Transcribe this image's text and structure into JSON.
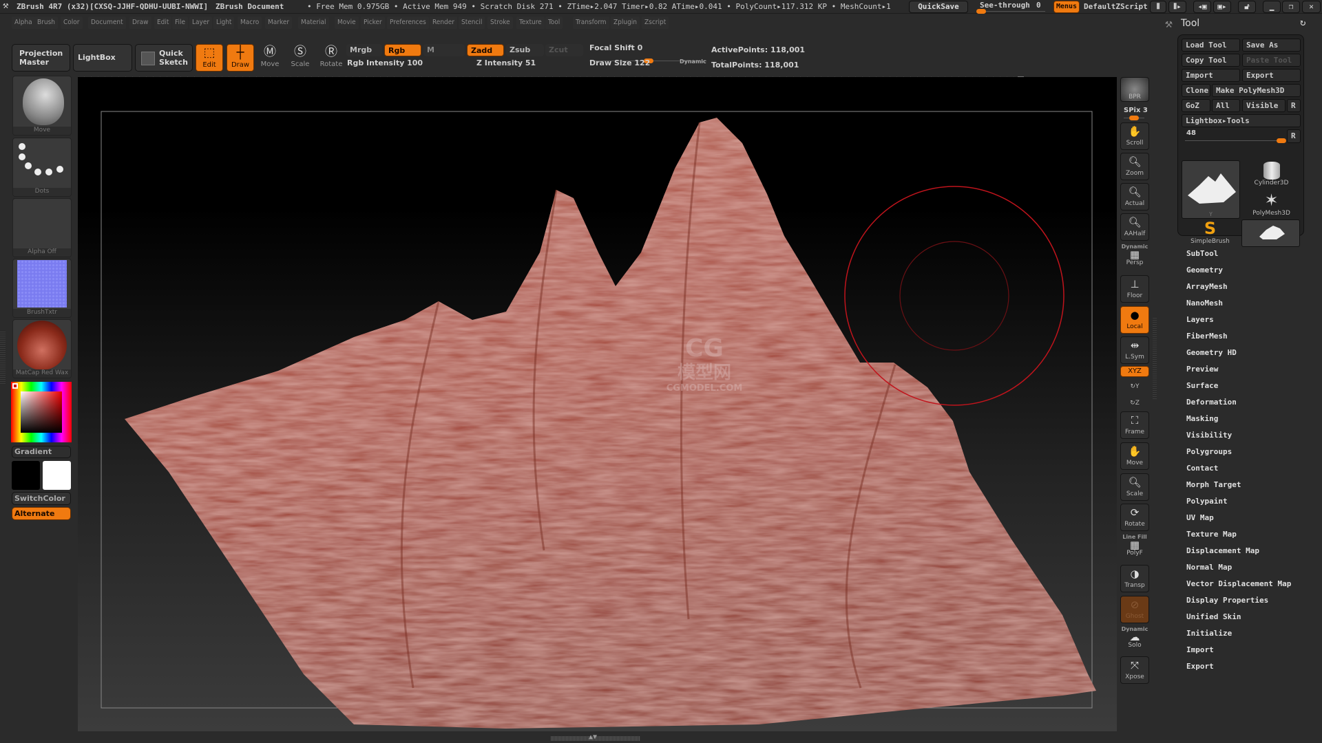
{
  "titlebar": {
    "app": "ZBrush 4R7 (x32)[CXSQ-JJHF-QDHU-UUBI-NWWI]",
    "document": "ZBrush Document",
    "stats": "• Free Mem 0.975GB • Active Mem 949 • Scratch Disk 271 • ZTime▸2.047 Timer▸0.82 ATime▸0.041 • PolyCount▸117.312 KP • MeshCount▸1",
    "quicksave": "QuickSave",
    "see_through_label": "See-through",
    "see_through_value": "0",
    "see_through_level": 0,
    "menus": "Menus",
    "script": "DefaultZScript"
  },
  "menubar": [
    "Alpha",
    "Brush",
    "Color",
    "Document",
    "Draw",
    "Edit",
    "File",
    "Layer",
    "Light",
    "Macro",
    "Marker",
    "Material",
    "Movie",
    "Picker",
    "Preferences",
    "Render",
    "Stencil",
    "Stroke",
    "Texture",
    "Tool",
    "Transform",
    "Zplugin",
    "Zscript"
  ],
  "toolbar": {
    "projection_master": [
      "Projection",
      "Master"
    ],
    "lightbox": "LightBox",
    "quick_sketch": [
      "Quick",
      "Sketch"
    ],
    "edit": "Edit",
    "draw": "Draw",
    "move": "Move",
    "scale": "Scale",
    "rotate": "Rotate",
    "mrgb": "Mrgb",
    "rgb": "Rgb",
    "m": "M",
    "zadd": "Zadd",
    "zsub": "Zsub",
    "zcut": "Zcut",
    "rgb_intensity": "Rgb Intensity 100",
    "rgb_intensity_value": 100,
    "z_intensity": "Z Intensity 51",
    "z_intensity_value": 51,
    "focal_shift": "Focal Shift 0",
    "focal_shift_value": 0,
    "draw_size": "Draw Size 122",
    "draw_size_value": 122,
    "dynamic": "Dynamic",
    "active_points": "ActivePoints: 118,001",
    "total_points": "TotalPoints: 118,001"
  },
  "leftpanel": {
    "brush": "Move",
    "stroke": "Dots",
    "alpha": "Alpha Off",
    "texture": "BrushTxtr",
    "material": "MatCap Red Wax",
    "gradient": "Gradient",
    "switch_color": "SwitchColor",
    "alternate": "Alternate",
    "main_color": "#000000",
    "secondary_color": "#ffffff"
  },
  "shelf": {
    "bpr": "BPR",
    "spix": "SPix 3",
    "scroll": "Scroll",
    "zoom": "Zoom",
    "actual": "Actual",
    "aahalf": "AAHalf",
    "dynamic": "Dynamic",
    "persp": "Persp",
    "floor": "Floor",
    "local": "Local",
    "lsym": "L.Sym",
    "xyz": "XYZ",
    "y": "Y",
    "z": "Z",
    "frame": "Frame",
    "move": "Move",
    "scale": "Scale",
    "rotate": "Rotate",
    "line_fill": "Line Fill",
    "polyf": "PolyF",
    "transp": "Transp",
    "ghost": "Ghost",
    "dynamic2": "Dynamic",
    "solo": "Solo",
    "xpose": "Xpose"
  },
  "toolpanel": {
    "title": "Tool",
    "load_tool": "Load Tool",
    "save_as": "Save As",
    "copy_tool": "Copy Tool",
    "paste_tool": "Paste Tool",
    "import": "Import",
    "export": "Export",
    "clone": "Clone",
    "make_polymesh": "Make PolyMesh3D",
    "goz": "GoZ",
    "all": "All",
    "visible": "Visible",
    "r": "R",
    "lightbox_tools": "Lightbox▸Tools",
    "size_value": "48",
    "thumbs": [
      "Cylinder3D",
      "PolyMesh3D",
      "SimpleBrush"
    ],
    "current_tool_caption": "Y",
    "sections": [
      "SubTool",
      "Geometry",
      "ArrayMesh",
      "NanoMesh",
      "Layers",
      "FiberMesh",
      "Geometry HD",
      "Preview",
      "Surface",
      "Deformation",
      "Masking",
      "Visibility",
      "Polygroups",
      "Contact",
      "Morph Target",
      "Polypaint",
      "UV Map",
      "Texture Map",
      "Displacement Map",
      "Normal Map",
      "Vector Displacement Map",
      "Display Properties",
      "Unified Skin",
      "Initialize",
      "Import",
      "Export"
    ]
  },
  "watermark": {
    "logo": "CG",
    "cn": "模型网",
    "en": "CGMODEL.COM"
  },
  "colors": {
    "accent": "#f07a10",
    "mesh": "#a8483a",
    "brush_ring": "#c0141c"
  }
}
